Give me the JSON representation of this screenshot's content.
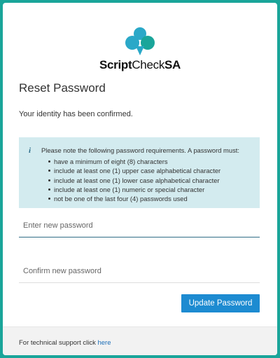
{
  "brand": {
    "name_part1": "Script",
    "name_part2": "Check",
    "name_part3": "SA",
    "logo_icon": "three-lobed-logo-icon",
    "logo_colors": [
      "#2aa8c8",
      "#1aa59a"
    ]
  },
  "page": {
    "title": "Reset Password",
    "confirmation": "Your identity has been confirmed."
  },
  "requirements": {
    "icon": "info-icon",
    "icon_glyph": "i",
    "intro": "Please note the following password requirements. A password must:",
    "items": [
      "have a minimum of eight (8) characters",
      "include at least one (1) upper case alphabetical character",
      "include at least one (1) lower case alphabetical character",
      "include at least one (1) numeric or special character",
      "not be one of the last four (4) passwords used"
    ]
  },
  "form": {
    "new_password_placeholder": "Enter new password",
    "confirm_password_placeholder": "Confirm new password",
    "submit_label": "Update Password"
  },
  "footer": {
    "text": "For technical support click",
    "link_text": "here"
  },
  "colors": {
    "background": "#1aa59a",
    "button": "#1d8bd1",
    "info_bg": "#d3ebef",
    "active_underline": "#2f6d86"
  }
}
